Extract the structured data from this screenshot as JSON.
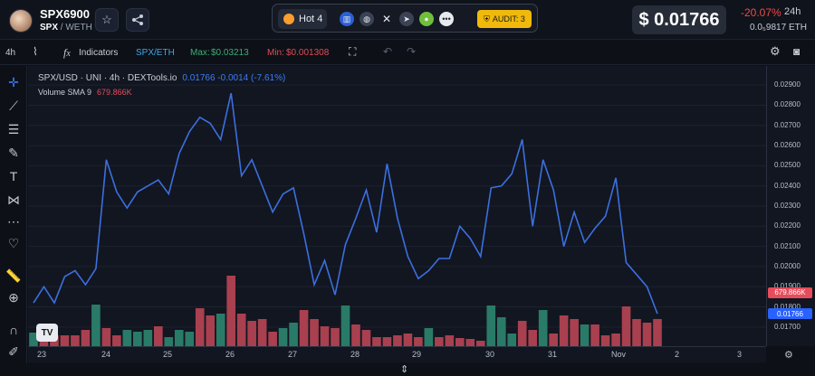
{
  "header": {
    "pair_name": "SPX6900",
    "pair_base": "SPX",
    "pair_quote": "WETH",
    "hot_label": "Hot",
    "hot_rank": "4",
    "audit_label": "AUDIT: 3",
    "price": "$ 0.01766",
    "change": "-20.07%",
    "change_period": "24h",
    "eth_price": "0.0₅9817 ETH"
  },
  "toolbar": {
    "interval": "4h",
    "indicators": "Indicators",
    "pair_toggle": "SPX/ETH",
    "max_label": "Max:",
    "max_value": "$0.03213",
    "min_label": "Min:",
    "min_value": "$0.001308"
  },
  "legend": {
    "title": "SPX/USD · UNI · 4h · DEXTools.io",
    "values": "0.01766 -0.0014 (-7.61%)",
    "volume_label": "Volume SMA 9",
    "volume_value": "679.866K"
  },
  "yaxis": {
    "ticks": [
      "0.02900",
      "0.02800",
      "0.02700",
      "0.02600",
      "0.02500",
      "0.02400",
      "0.02300",
      "0.02200",
      "0.02100",
      "0.02000",
      "0.01900",
      "0.01800",
      "0.01700"
    ],
    "volume_badge": "679.866K",
    "price_badge": "0.01766"
  },
  "xaxis": {
    "ticks": [
      "23",
      "24",
      "25",
      "26",
      "27",
      "28",
      "29",
      "30",
      "31",
      "Nov",
      "2",
      "3"
    ]
  },
  "colors": {
    "line": "#3b6fe0",
    "vol_up": "#2a7a68",
    "vol_down": "#a8404f",
    "accent_red": "#f04a4a"
  },
  "chart_data": {
    "type": "line",
    "x": [
      "23",
      "24",
      "25",
      "26",
      "27",
      "28",
      "29",
      "30",
      "31",
      "Nov"
    ],
    "ylim": [
      0.0165,
      0.0295
    ],
    "series": [
      {
        "values": [
          0.0182,
          0.019,
          0.0182,
          0.0195,
          0.0198,
          0.0191,
          0.0199,
          0.0253,
          0.0237,
          0.0229,
          0.0237,
          0.024,
          0.0243,
          0.0236,
          0.0256,
          0.0267,
          0.0274,
          0.0271,
          0.0263,
          0.0286,
          0.0245,
          0.0253,
          0.024,
          0.0227,
          0.0236,
          0.0239,
          0.0216,
          0.0191,
          0.0203,
          0.0186,
          0.0211,
          0.0224,
          0.0238,
          0.0217,
          0.0251,
          0.0224,
          0.0205,
          0.0194,
          0.0198,
          0.0204,
          0.0204,
          0.022,
          0.0214,
          0.0205,
          0.0239,
          0.024,
          0.0246,
          0.0263,
          0.022,
          0.0253,
          0.0238,
          0.021,
          0.0227,
          0.0212,
          0.0219,
          0.0225,
          0.0244,
          0.0202,
          0.0196,
          0.019,
          0.01766
        ]
      }
    ],
    "volume": {
      "name": "Volume",
      "values": [
        0.15,
        0.06,
        0.12,
        0.12,
        0.12,
        0.18,
        0.46,
        0.2,
        0.12,
        0.18,
        0.16,
        0.18,
        0.22,
        0.1,
        0.18,
        0.16,
        0.42,
        0.34,
        0.36,
        0.78,
        0.36,
        0.28,
        0.3,
        0.16,
        0.2,
        0.26,
        0.4,
        0.3,
        0.22,
        0.2,
        0.45,
        0.24,
        0.18,
        0.1,
        0.1,
        0.12,
        0.14,
        0.1,
        0.2,
        0.1,
        0.12,
        0.09,
        0.08,
        0.06,
        0.45,
        0.32,
        0.14,
        0.28,
        0.18,
        0.4,
        0.14,
        0.34,
        0.3,
        0.24,
        0.24,
        0.12,
        0.14,
        0.44,
        0.3,
        0.26,
        0.3
      ],
      "up": [
        true,
        false,
        false,
        false,
        false,
        false,
        true,
        false,
        false,
        true,
        true,
        true,
        false,
        true,
        true,
        true,
        false,
        false,
        true,
        false,
        false,
        false,
        false,
        false,
        true,
        true,
        false,
        false,
        false,
        false,
        true,
        false,
        false,
        false,
        false,
        false,
        false,
        false,
        true,
        false,
        false,
        false,
        false,
        false,
        true,
        true,
        true,
        false,
        false,
        true,
        false,
        false,
        false,
        true,
        false,
        false,
        false,
        false,
        false,
        false,
        false
      ]
    }
  }
}
